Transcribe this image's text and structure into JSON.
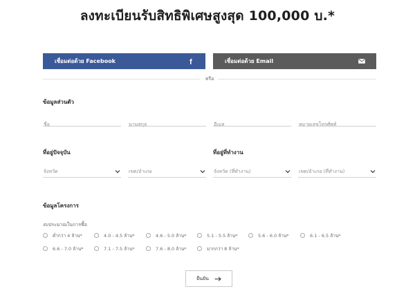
{
  "title": "ลงทะเบียนรับสิทธิพิเศษสูงสุด 100,000 บ.*",
  "social": {
    "facebook_label": "เชื่อมต่อด้วย Facebook",
    "facebook_icon": "facebook-icon",
    "facebook_color": "#3b5998",
    "email_label": "เชื่อมต่อด้วย Email",
    "email_icon": "envelope-icon",
    "email_color": "#5b5b5b",
    "or_text": "หรือ"
  },
  "personal": {
    "title": "ข้อมูลส่วนตัว",
    "fields": [
      {
        "placeholder": "ชื่อ",
        "value": ""
      },
      {
        "placeholder": "นามสกุล",
        "value": ""
      },
      {
        "placeholder": "อีเมล",
        "value": ""
      },
      {
        "placeholder": "หมายเลขโทรศัพท์",
        "value": ""
      }
    ]
  },
  "current_address": {
    "title": "ที่อยู่ปัจจุบัน",
    "province": "จังหวัด",
    "district": "เขต/อำเภอ"
  },
  "work_address": {
    "title": "ที่อยู่ที่ทำงาน",
    "province": "จังหวัด (ที่ทำงาน)",
    "district": "เขต/อำเภอ (ที่ทำงาน)"
  },
  "project": {
    "title": "ข้อมูลโครงการ",
    "budget_title": "งบประมาณในการซื้อ",
    "budget_options": [
      "ต่ำกว่า 4 ล้าน*",
      "4.0 - 4.5 ล้าน*",
      "4.6 - 5.0 ล้าน*",
      "5.1 - 5.5 ล้าน*",
      "5.6 - 6.0 ล้าน*",
      "6.1 - 6.5 ล้าน*",
      "6.6 - 7.0 ล้าน*",
      "7.1 - 7.5 ล้าน*",
      "7.6 - 8.0 ล้าน*",
      "มากกว่า 8 ล้าน*"
    ]
  },
  "submit": {
    "label": "ยืนยัน",
    "icon": "arrow-right-icon"
  }
}
